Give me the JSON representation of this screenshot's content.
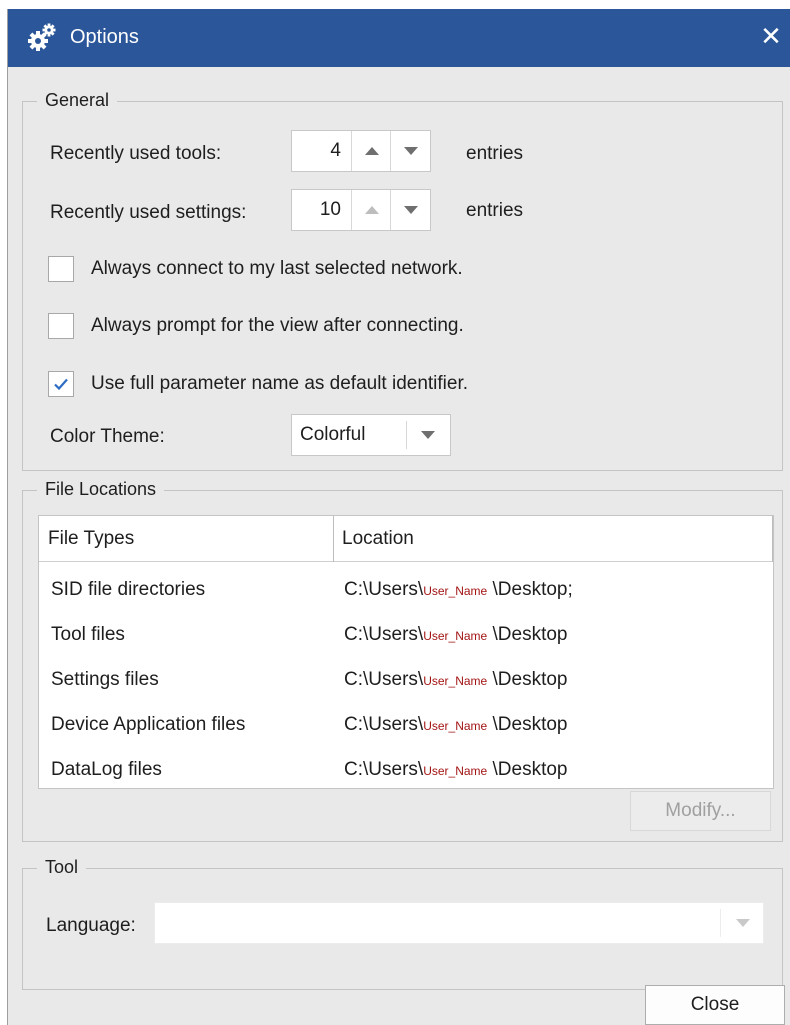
{
  "window": {
    "title": "Options",
    "close_symbol": "✕",
    "titlebar_color": "#2b579a"
  },
  "general": {
    "legend": "General",
    "recent_tools": {
      "label": "Recently used tools:",
      "value": "4",
      "suffix": "entries"
    },
    "recent_settings": {
      "label": "Recently used settings:",
      "value": "10",
      "suffix": "entries"
    },
    "checkboxes": [
      {
        "label": "Always connect to my last selected network.",
        "checked": false
      },
      {
        "label": "Always prompt for the view after connecting.",
        "checked": false
      },
      {
        "label": "Use full parameter name as default identifier.",
        "checked": true
      }
    ],
    "color_theme": {
      "label": "Color Theme:",
      "value": "Colorful"
    }
  },
  "file_locations": {
    "legend": "File Locations",
    "columns": [
      "File Types",
      "Location"
    ],
    "rows": [
      {
        "type": "SID file directories",
        "loc_prefix": "C:\\Users\\",
        "user": "User_Name",
        "loc_suffix": " \\Desktop;"
      },
      {
        "type": "Tool files",
        "loc_prefix": "C:\\Users\\",
        "user": "User_Name",
        "loc_suffix": " \\Desktop"
      },
      {
        "type": "Settings files",
        "loc_prefix": "C:\\Users\\",
        "user": "User_Name",
        "loc_suffix": " \\Desktop"
      },
      {
        "type": "Device Application files",
        "loc_prefix": "C:\\Users\\",
        "user": "User_Name",
        "loc_suffix": " \\Desktop"
      },
      {
        "type": "DataLog files",
        "loc_prefix": "C:\\Users\\",
        "user": "User_Name",
        "loc_suffix": " \\Desktop"
      }
    ],
    "modify_label": "Modify..."
  },
  "tool": {
    "legend": "Tool",
    "language_label": "Language:",
    "language_value": ""
  },
  "footer": {
    "close_label": "Close"
  },
  "colors": {
    "accent_check": "#2b6cc4",
    "username": "#a31515"
  },
  "icons": {
    "title": "gears-icon",
    "close": "close-icon",
    "check": "checkmark-icon"
  }
}
